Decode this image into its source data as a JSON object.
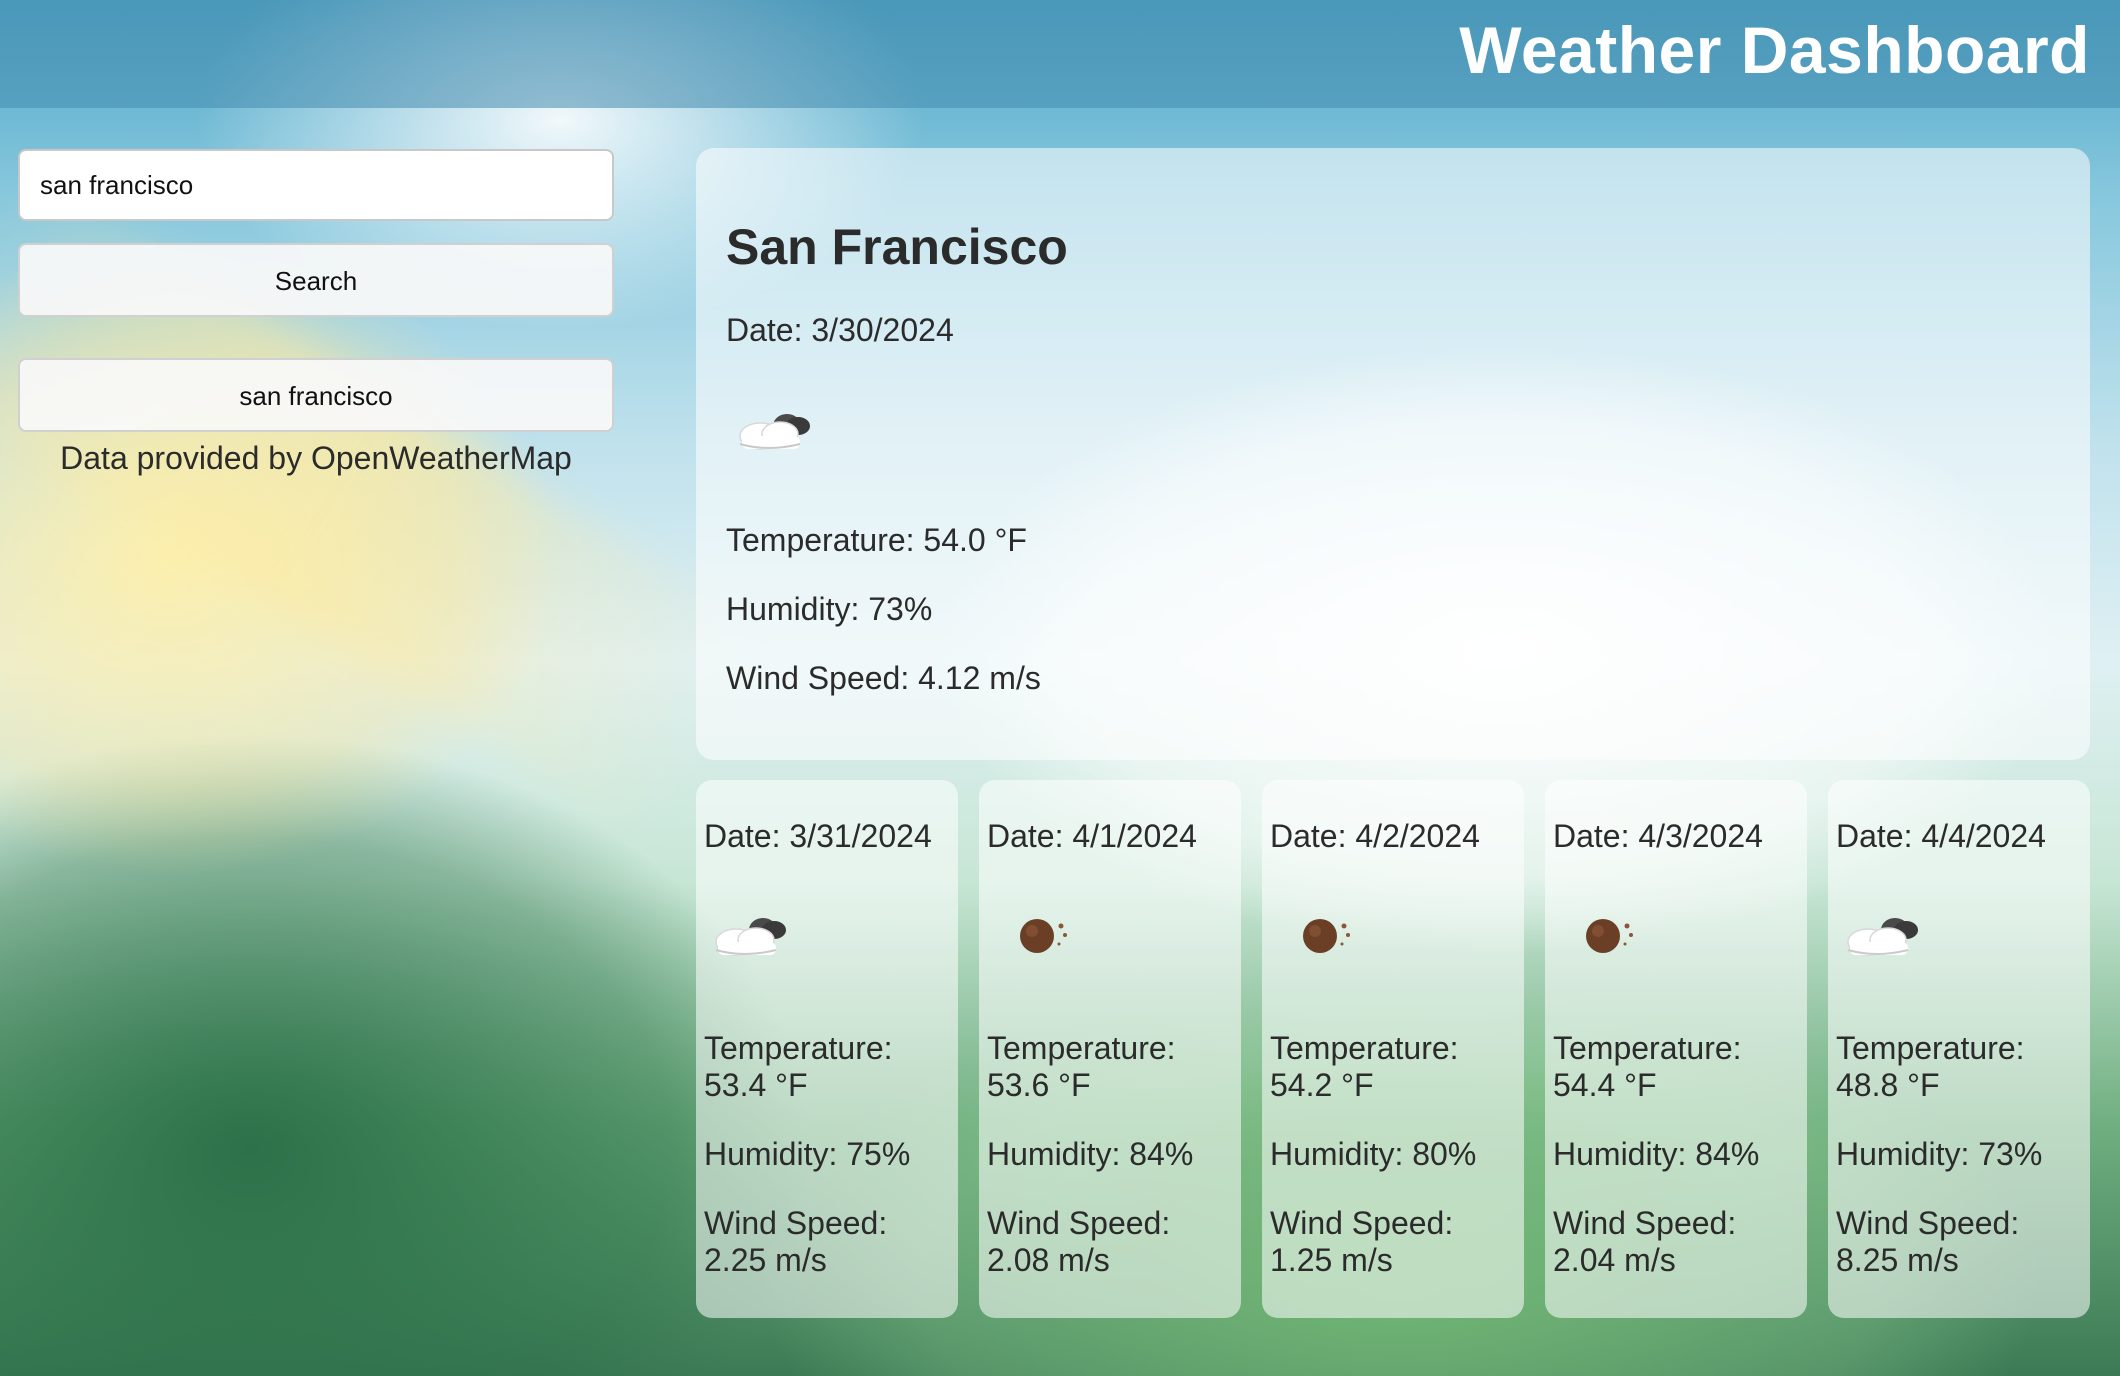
{
  "header": {
    "title": "Weather Dashboard"
  },
  "sidebar": {
    "search_value": "san francisco",
    "search_button_label": "Search",
    "history": [
      "san francisco"
    ],
    "credit": "Data provided by OpenWeatherMap"
  },
  "current": {
    "city": "San Francisco",
    "date": "Date: 3/30/2024",
    "icon": "cloudy-night-icon",
    "temperature": "Temperature: 54.0 °F",
    "humidity": "Humidity: 73%",
    "wind": "Wind Speed: 4.12 m/s"
  },
  "forecast": [
    {
      "date": "Date: 3/31/2024",
      "icon": "cloudy-night-icon",
      "temp_label": "Temperature:",
      "temp": "53.4 °F",
      "humidity": "Humidity: 75%",
      "wind_label": "Wind Speed:",
      "wind": "2.25 m/s"
    },
    {
      "date": "Date: 4/1/2024",
      "icon": "clear-night-icon",
      "temp_label": "Temperature:",
      "temp": "53.6 °F",
      "humidity": "Humidity: 84%",
      "wind_label": "Wind Speed:",
      "wind": "2.08 m/s"
    },
    {
      "date": "Date: 4/2/2024",
      "icon": "clear-night-icon",
      "temp_label": "Temperature:",
      "temp": "54.2 °F",
      "humidity": "Humidity: 80%",
      "wind_label": "Wind Speed:",
      "wind": "1.25 m/s"
    },
    {
      "date": "Date: 4/3/2024",
      "icon": "clear-night-icon",
      "temp_label": "Temperature:",
      "temp": "54.4 °F",
      "humidity": "Humidity: 84%",
      "wind_label": "Wind Speed:",
      "wind": "2.04 m/s"
    },
    {
      "date": "Date: 4/4/2024",
      "icon": "cloudy-night-icon",
      "temp_label": "Temperature:",
      "temp": "48.8 °F",
      "humidity": "Humidity: 73%",
      "wind_label": "Wind Speed:",
      "wind": "8.25 m/s"
    }
  ],
  "colors": {
    "header_bg": "#468caf",
    "title": "#ffffff",
    "text": "#2b2b2b",
    "card_bg": "#ffffff"
  }
}
